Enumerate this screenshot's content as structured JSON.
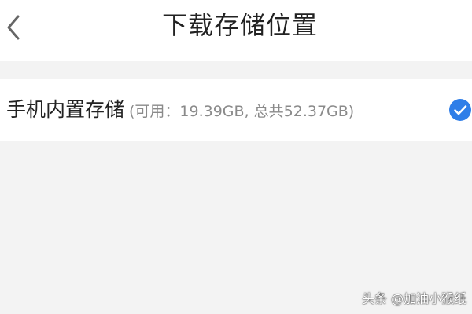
{
  "header": {
    "title": "下载存储位置",
    "back_icon": "chevron-left-icon"
  },
  "storage_options": [
    {
      "name": "手机内置存储",
      "detail": "(可用：19.39GB, 总共52.37GB)",
      "selected": true,
      "selected_icon": "check-circle-icon"
    }
  ],
  "watermark": "头条 @加油小猴纸",
  "colors": {
    "accent": "#2f7ee8",
    "background": "#f3f3f3",
    "surface": "#ffffff",
    "text_primary": "#222222",
    "text_secondary": "#8a8a8a"
  }
}
